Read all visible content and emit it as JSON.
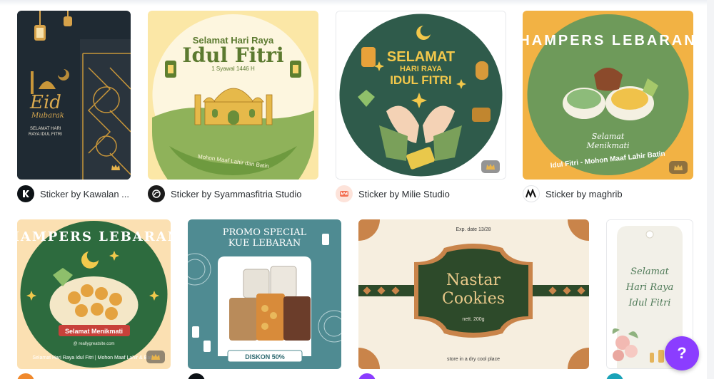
{
  "colors": {
    "accent": "#8b3dff",
    "crown_gold": "#e8b44c"
  },
  "help": {
    "label": "?"
  },
  "row1": [
    {
      "creator": "Sticker by Kawalan ...",
      "text": {
        "eid": "Eid",
        "mubarak": "Mubarak",
        "line1": "SELAMAT HARI",
        "line2": "RAYA IDUL FITRI"
      }
    },
    {
      "creator": "Sticker by Syammasfitria Studio",
      "text": {
        "top": "Selamat Hari Raya",
        "title": "Idul Fitri",
        "date": "1 Syawal 1446 H",
        "bottom": "Mohon Maaf Lahir dan Batin"
      }
    },
    {
      "creator": "Sticker by Milie Studio",
      "text": {
        "line1": "SELAMAT",
        "line2": "HARI RAYA",
        "line3": "IDUL FITRI"
      }
    },
    {
      "creator": "Sticker by maghrib",
      "text": {
        "arc": "HAMPERS LEBARAN",
        "line1": "Selamat",
        "line2": "Menikmati",
        "bottom": "Idul Fitri - Mohon Maaf Lahir Batin"
      }
    }
  ],
  "row2": [
    {
      "text": {
        "arc": "HAMPERS LEBARAN",
        "ribbon": "Selamat Menikmati",
        "handle": "@ reallygreatsite.com",
        "bottom": "Selamat Hari Raya Idul Fitri | Mohon Maaf Lahir & Batin"
      }
    },
    {
      "text": {
        "line1": "PROMO SPECIAL",
        "line2": "KUE LEBARAN",
        "badge": "DISKON 50%"
      }
    },
    {
      "text": {
        "exp": "Exp. date 13/28",
        "title1": "Nastar",
        "title2": "Cookies",
        "netto": "nett. 200g",
        "store": "store in a dry cool place"
      }
    },
    {
      "text": {
        "line1": "Selamat",
        "line2": "Hari Raya",
        "line3": "Idul Fitri"
      }
    }
  ]
}
